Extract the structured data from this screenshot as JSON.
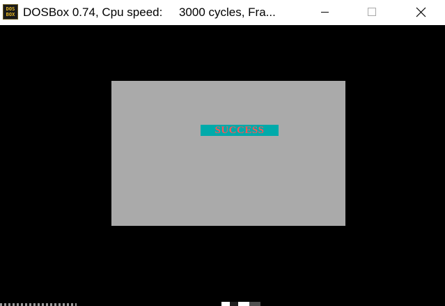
{
  "window": {
    "title": "DOSBox 0.74, Cpu speed:     3000 cycles, Fra...",
    "icon": {
      "name": "dosbox-icon",
      "line1": "DOS",
      "line2": "BOX"
    },
    "controls": [
      "minimize",
      "maximize",
      "close"
    ]
  },
  "screen": {
    "dialog": {
      "message": "SUCCESS"
    }
  },
  "colors": {
    "titlebar": "#ffffff",
    "screen_bg": "#000000",
    "dialog_bg": "#aaaaaa",
    "message_bg": "#00aaaa",
    "message_text": "#ff5555"
  }
}
